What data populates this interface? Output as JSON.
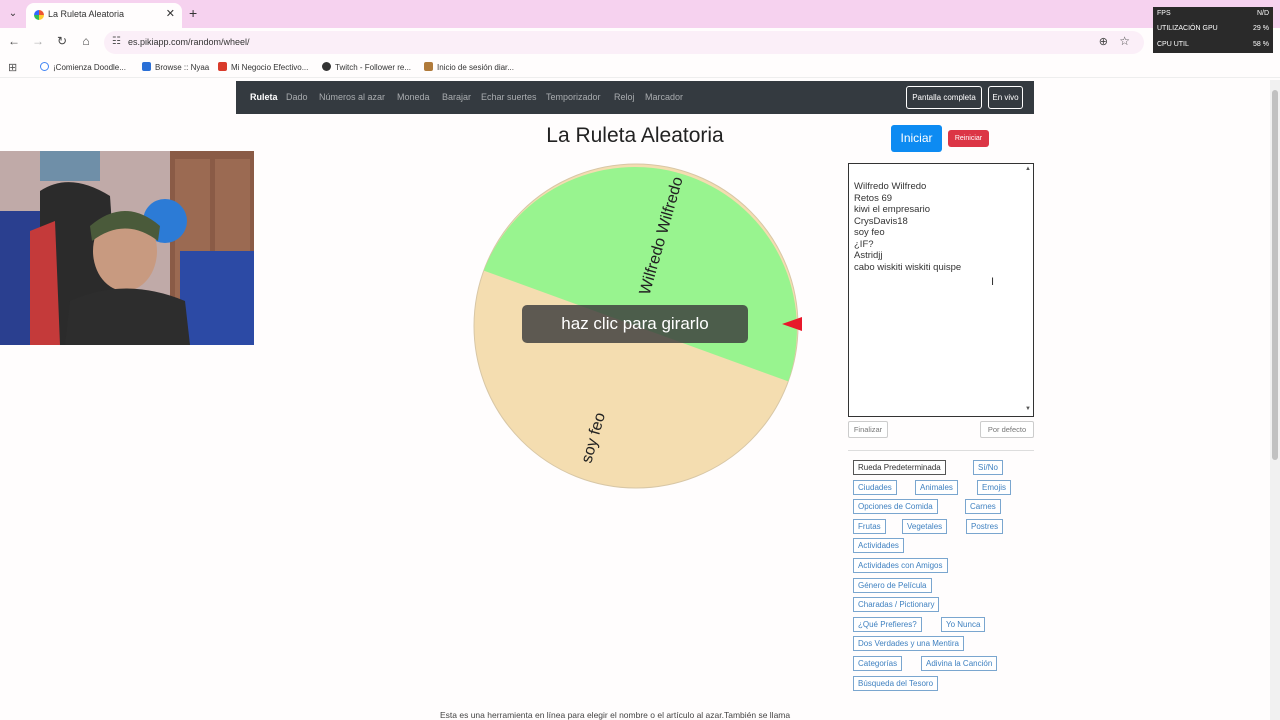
{
  "browser": {
    "tab_title": "La Ruleta Aleatoria",
    "url": "es.pikiapp.com/random/wheel/",
    "bookmarks": [
      "¡Comienza Doodle...",
      "Browse :: Nyaa",
      "Mi Negocio Efectivo...",
      "Twitch - Follower re...",
      "Inicio de sesión diar..."
    ]
  },
  "perf_overlay": {
    "rows": [
      {
        "label": "FPS",
        "value": "N/D"
      },
      {
        "label": "UTILIZACIÓN GPU",
        "value": "29 %"
      },
      {
        "label": "CPU UTIL",
        "value": "58 %"
      }
    ]
  },
  "navbar": {
    "links": [
      "Ruleta",
      "Dado",
      "Números al azar",
      "Moneda",
      "Barajar",
      "Echar suertes",
      "Temporizador",
      "Reloj",
      "Marcador"
    ],
    "fullscreen_label": "Pantalla completa",
    "live_label": "En vivo"
  },
  "page": {
    "title": "La Ruleta Aleatoria",
    "spin_label": "haz clic para girarlo",
    "wheel_labels": [
      "Wilfredo Wilfredo",
      "soy feo"
    ],
    "colors": {
      "green": "#98f48f",
      "tan": "#f4ddb0",
      "pointer": "#e8182a"
    }
  },
  "controls": {
    "start_label": "Iniciar",
    "reset_label": "Reiniciar",
    "names": [
      "Wilfredo Wilfredo",
      "Retos 69",
      "kiwi el empresario",
      "CrysDavis18",
      "soy feo",
      "¿IF?",
      "Astridjj",
      "cabo wiskiti wiskiti quispe"
    ],
    "finish_label": "Finalizar",
    "default_label": "Por defecto"
  },
  "presets": [
    "Rueda Predeterminada",
    "Sí/No",
    "Ciudades",
    "Animales",
    "Emojis",
    "Opciones de Comida",
    "Carnes",
    "Frutas",
    "Vegetales",
    "Postres",
    "Actividades",
    "Actividades con Amigos",
    "Género de Película",
    "Charadas / Pictionary",
    "¿Qué Prefieres?",
    "Yo Nunca",
    "Dos Verdades y una Mentira",
    "Categorías",
    "Adivina la Canción",
    "Búsqueda del Tesoro"
  ],
  "footer": "Esta es una herramienta en línea para elegir el nombre o el artículo al azar.También se llama"
}
